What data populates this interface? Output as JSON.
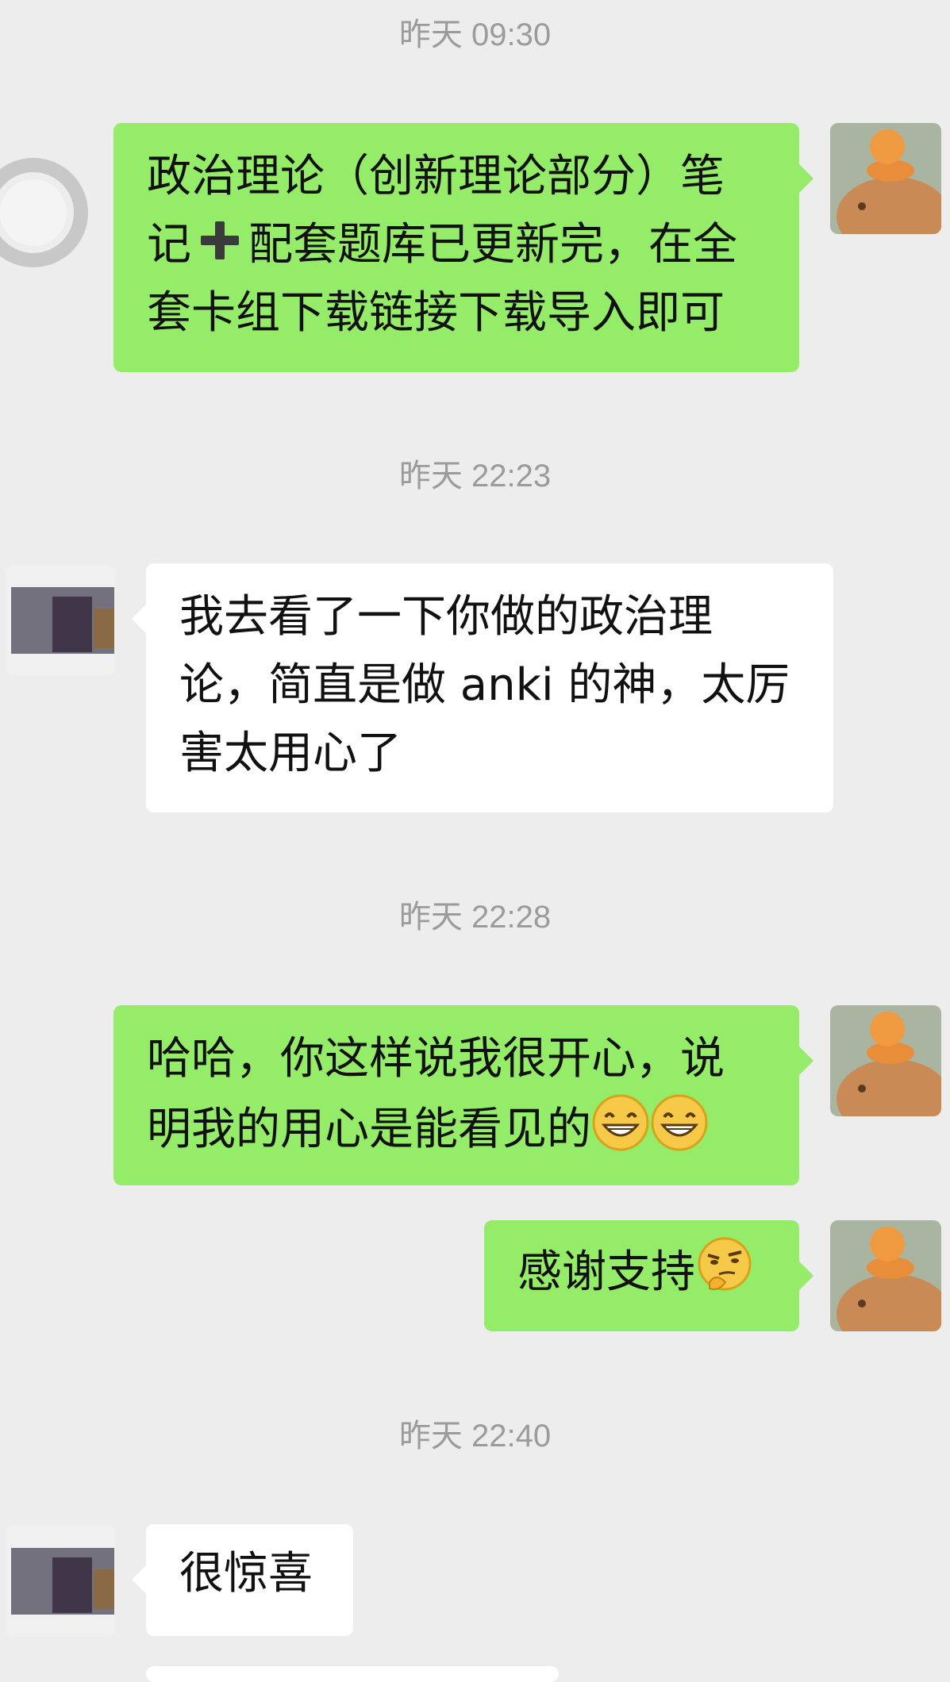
{
  "colors": {
    "background": "#ededed",
    "outgoing_bubble": "#95ec69",
    "incoming_bubble": "#ffffff",
    "timestamp": "#9b9b9b"
  },
  "messages": [
    {
      "time": "昨天 09:30",
      "sender": "self",
      "text_before": "政治理论（创新理论部分）笔记",
      "icon": "plus-icon",
      "text_after": "配套题库已更新完，在全套卡组下载链接下载导入即可"
    },
    {
      "time": "昨天 22:23",
      "sender": "other",
      "text": "我去看了一下你做的政治理论，简直是做 anki 的神，太厉害太用心了"
    },
    {
      "time": "昨天 22:28",
      "sender": "self",
      "text": "哈哈，你这样说我很开心，说明我的用心是能看见的",
      "emojis": [
        "grin-emoji",
        "grin-emoji"
      ]
    },
    {
      "sender": "self",
      "text": "感谢支持",
      "emojis": [
        "thinking-emoji"
      ]
    },
    {
      "time": "昨天 22:40",
      "sender": "other",
      "text": "很惊喜"
    }
  ]
}
